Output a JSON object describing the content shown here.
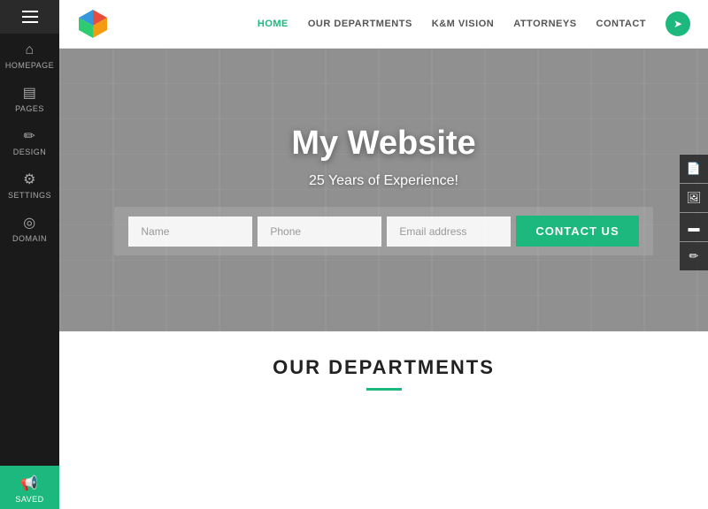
{
  "sidebar": {
    "menu_label": "☰",
    "items": [
      {
        "id": "homepage",
        "label": "HOMEPAGE",
        "icon": "⌂"
      },
      {
        "id": "pages",
        "label": "PAGES",
        "icon": "▤"
      },
      {
        "id": "design",
        "label": "DESIGN",
        "icon": "✏"
      },
      {
        "id": "settings",
        "label": "SeTtinGs",
        "icon": "⚙"
      },
      {
        "id": "domain",
        "label": "DOMAIN",
        "icon": "◎"
      }
    ],
    "saved_item": {
      "label": "Saved",
      "icon": "📢"
    }
  },
  "topnav": {
    "nav_links": [
      {
        "id": "home",
        "label": "HOME",
        "active": true
      },
      {
        "id": "departments",
        "label": "OUR DEPARTMENTS",
        "active": false
      },
      {
        "id": "kmvision",
        "label": "K&M VISION",
        "active": false
      },
      {
        "id": "attorneys",
        "label": "ATTORNEYS",
        "active": false
      },
      {
        "id": "contact",
        "label": "CONTACT",
        "active": false
      }
    ],
    "location_icon": "➤"
  },
  "right_toolbar": {
    "buttons": [
      {
        "id": "doc",
        "icon": "📄"
      },
      {
        "id": "image",
        "icon": "🖼"
      },
      {
        "id": "video",
        "icon": "▬"
      },
      {
        "id": "edit",
        "icon": "✏"
      }
    ]
  },
  "hero": {
    "title": "My Website",
    "subtitle": "25 Years of Experience!",
    "form": {
      "name_placeholder": "Name",
      "phone_placeholder": "Phone",
      "email_placeholder": "Email address",
      "button_label": "CONTACT US"
    }
  },
  "departments_section": {
    "title": "OUR DEPARTMENTS"
  }
}
